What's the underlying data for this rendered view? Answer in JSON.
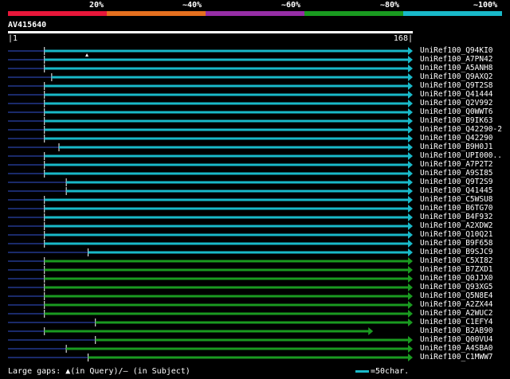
{
  "scale": {
    "labels": [
      "20%",
      "~40%",
      "~60%",
      "~80%",
      "~100%"
    ],
    "colors": [
      "#e8173a",
      "#e5701f",
      "#962ea6",
      "#1a9a20",
      "#19b9c9"
    ]
  },
  "query": {
    "name": "AV415640",
    "start": "1",
    "end": "168"
  },
  "hits": [
    {
      "name": "UniRef100_Q94KI0",
      "start": 0.09,
      "end": 1.0,
      "color": "#19b9c9",
      "gap_query": 0.195
    },
    {
      "name": "UniRef100_A7PN42",
      "start": 0.09,
      "end": 1.0,
      "color": "#19b9c9"
    },
    {
      "name": "UniRef100_A5ANH8",
      "start": 0.09,
      "end": 1.0,
      "color": "#19b9c9"
    },
    {
      "name": "UniRef100_Q9AXQ2",
      "start": 0.108,
      "end": 1.0,
      "color": "#19b9c9"
    },
    {
      "name": "UniRef100_Q9T2S8",
      "start": 0.09,
      "end": 1.0,
      "color": "#19b9c9"
    },
    {
      "name": "UniRef100_Q41444",
      "start": 0.09,
      "end": 1.0,
      "color": "#19b9c9"
    },
    {
      "name": "UniRef100_Q2V992",
      "start": 0.09,
      "end": 1.0,
      "color": "#19b9c9"
    },
    {
      "name": "UniRef100_Q0WWT6",
      "start": 0.09,
      "end": 1.0,
      "color": "#19b9c9"
    },
    {
      "name": "UniRef100_B9IK63",
      "start": 0.09,
      "end": 1.0,
      "color": "#19b9c9"
    },
    {
      "name": "UniRef100_Q42290-2",
      "start": 0.09,
      "end": 1.0,
      "color": "#19b9c9"
    },
    {
      "name": "UniRef100_Q42290",
      "start": 0.09,
      "end": 1.0,
      "color": "#19b9c9"
    },
    {
      "name": "UniRef100_B9H0J1",
      "start": 0.126,
      "end": 1.0,
      "color": "#19b9c9"
    },
    {
      "name": "UniRef100_UPI000..",
      "start": 0.09,
      "end": 1.0,
      "color": "#19b9c9"
    },
    {
      "name": "UniRef100_A7P2T2",
      "start": 0.09,
      "end": 1.0,
      "color": "#19b9c9"
    },
    {
      "name": "UniRef100_A9SI85",
      "start": 0.09,
      "end": 1.0,
      "color": "#19b9c9"
    },
    {
      "name": "UniRef100_Q9T2S9",
      "start": 0.144,
      "end": 1.0,
      "color": "#19b9c9"
    },
    {
      "name": "UniRef100_Q41445",
      "start": 0.144,
      "end": 1.0,
      "color": "#19b9c9"
    },
    {
      "name": "UniRef100_C5WSU8",
      "start": 0.09,
      "end": 1.0,
      "color": "#19b9c9"
    },
    {
      "name": "UniRef100_B6TG70",
      "start": 0.09,
      "end": 1.0,
      "color": "#19b9c9"
    },
    {
      "name": "UniRef100_B4F932",
      "start": 0.09,
      "end": 1.0,
      "color": "#19b9c9"
    },
    {
      "name": "UniRef100_A2XDW2",
      "start": 0.09,
      "end": 1.0,
      "color": "#19b9c9"
    },
    {
      "name": "UniRef100_Q10Q21",
      "start": 0.09,
      "end": 1.0,
      "color": "#19b9c9"
    },
    {
      "name": "UniRef100_B9F658",
      "start": 0.09,
      "end": 1.0,
      "color": "#19b9c9"
    },
    {
      "name": "UniRef100_B9SJC9",
      "start": 0.198,
      "end": 1.0,
      "color": "#19b9c9"
    },
    {
      "name": "UniRef100_C5XI82",
      "start": 0.09,
      "end": 1.0,
      "color": "#1a9a20"
    },
    {
      "name": "UniRef100_B7ZXD1",
      "start": 0.09,
      "end": 1.0,
      "color": "#1a9a20"
    },
    {
      "name": "UniRef100_Q0JJX0",
      "start": 0.09,
      "end": 1.0,
      "color": "#1a9a20"
    },
    {
      "name": "UniRef100_Q93XG5",
      "start": 0.09,
      "end": 1.0,
      "color": "#1a9a20"
    },
    {
      "name": "UniRef100_Q5N8E4",
      "start": 0.09,
      "end": 1.0,
      "color": "#1a9a20"
    },
    {
      "name": "UniRef100_A2ZX44",
      "start": 0.09,
      "end": 1.0,
      "color": "#1a9a20"
    },
    {
      "name": "UniRef100_A2WUC2",
      "start": 0.09,
      "end": 1.0,
      "color": "#1a9a20"
    },
    {
      "name": "UniRef100_C1EFY4",
      "start": 0.216,
      "end": 1.0,
      "color": "#1a9a20"
    },
    {
      "name": "UniRef100_B2AB90",
      "start": 0.09,
      "end": 0.902,
      "color": "#1a9a20"
    },
    {
      "name": "UniRef100_Q00VU4",
      "start": 0.216,
      "end": 1.0,
      "color": "#1a9a20"
    },
    {
      "name": "UniRef100_A4SBA0",
      "start": 0.144,
      "end": 1.0,
      "color": "#1a9a20"
    },
    {
      "name": "UniRef100_C1MWW7",
      "start": 0.198,
      "end": 1.0,
      "color": "#1a9a20"
    }
  ],
  "legend": {
    "gaps_text": "Large gaps: ",
    "query_marker_text": "(in Query)/",
    "subject_marker": "–",
    "subject_text": " (in Subject)",
    "scale_text": "=50char."
  }
}
